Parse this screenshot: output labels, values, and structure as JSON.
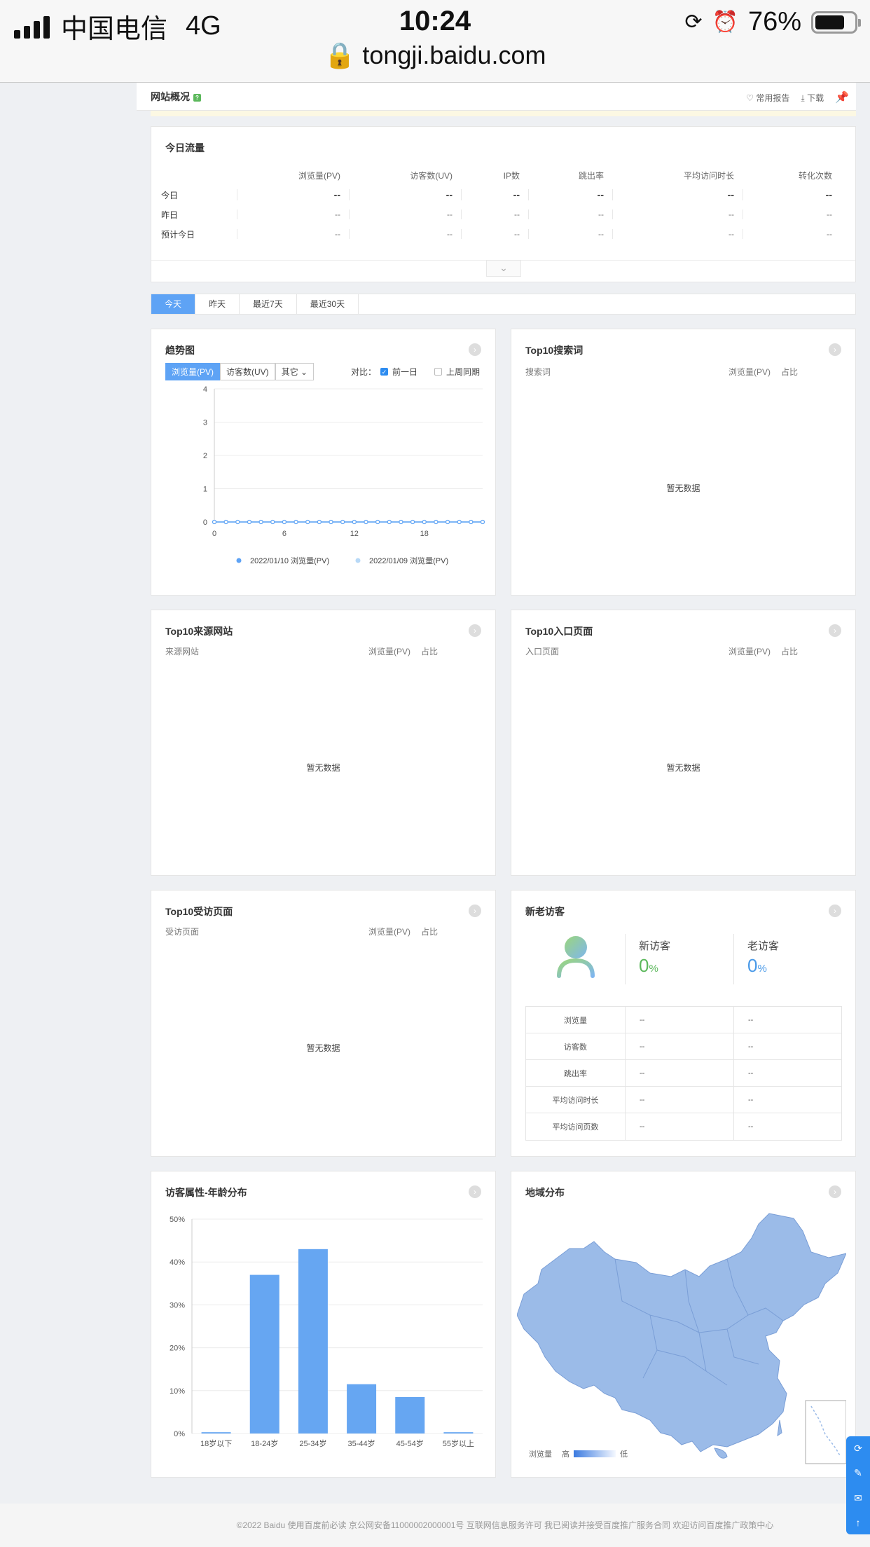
{
  "status_bar": {
    "carrier": "中国电信",
    "network": "4G",
    "time": "10:24",
    "battery": "76%",
    "url": "tongji.baidu.com"
  },
  "header": {
    "title": "网站概况",
    "badge": "?",
    "actions": [
      "常用报告",
      "下载"
    ]
  },
  "today_traffic": {
    "title": "今日流量",
    "columns": [
      "浏览量(PV)",
      "访客数(UV)",
      "IP数",
      "跳出率",
      "平均访问时长",
      "转化次数"
    ],
    "rows": [
      {
        "label": "今日",
        "values": [
          "--",
          "--",
          "--",
          "--",
          "--",
          "--"
        ]
      },
      {
        "label": "昨日",
        "values": [
          "--",
          "--",
          "--",
          "--",
          "--",
          "--"
        ]
      },
      {
        "label": "预计今日",
        "values": [
          "--",
          "--",
          "--",
          "--",
          "--",
          "--"
        ]
      }
    ]
  },
  "date_tabs": [
    "今天",
    "昨天",
    "最近7天",
    "最近30天"
  ],
  "trend": {
    "title": "趋势图",
    "metric_tabs": [
      "浏览量(PV)",
      "访客数(UV)",
      "其它"
    ],
    "compare_label": "对比：",
    "compare_options": [
      "前一日",
      "上周同期"
    ],
    "legend": [
      "2022/01/10 浏览量(PV)",
      "2022/01/09 浏览量(PV)"
    ]
  },
  "top_search": {
    "title": "Top10搜索词",
    "cols": [
      "搜索词",
      "浏览量(PV)",
      "占比"
    ],
    "empty": "暂无数据"
  },
  "top_source": {
    "title": "Top10来源网站",
    "cols": [
      "来源网站",
      "浏览量(PV)",
      "占比"
    ],
    "empty": "暂无数据"
  },
  "top_entry": {
    "title": "Top10入口页面",
    "cols": [
      "入口页面",
      "浏览量(PV)",
      "占比"
    ],
    "empty": "暂无数据"
  },
  "top_visited": {
    "title": "Top10受访页面",
    "cols": [
      "受访页面",
      "浏览量(PV)",
      "占比"
    ],
    "empty": "暂无数据"
  },
  "new_visitors": {
    "title": "新老访客",
    "new_label": "新访客",
    "old_label": "老访客",
    "new_pct": "0",
    "old_pct": "0",
    "pct_sign": "%",
    "rows": [
      {
        "label": "浏览量",
        "new": "--",
        "old": "--"
      },
      {
        "label": "访客数",
        "new": "--",
        "old": "--"
      },
      {
        "label": "跳出率",
        "new": "--",
        "old": "--"
      },
      {
        "label": "平均访问时长",
        "new": "--",
        "old": "--"
      },
      {
        "label": "平均访问页数",
        "new": "--",
        "old": "--"
      }
    ]
  },
  "age": {
    "title": "访客属性-年龄分布"
  },
  "geo": {
    "title": "地域分布",
    "legend_label": "浏览量",
    "high": "高",
    "low": "低"
  },
  "footer": {
    "text": "©2022 Baidu 使用百度前必读 京公网安备11000002000001号 互联网信息服务许可 我已阅读并接受百度推广服务合同 欢迎访问百度推广政策中心"
  },
  "chart_data": [
    {
      "type": "line",
      "x": [
        0,
        1,
        2,
        3,
        4,
        5,
        6,
        7,
        8,
        9,
        10,
        11,
        12,
        13,
        14,
        15,
        16,
        17,
        18,
        19,
        20,
        21,
        22,
        23
      ],
      "x_ticks": [
        "0",
        "6",
        "12",
        "18"
      ],
      "y_ticks": [
        "0",
        "1",
        "2",
        "3",
        "4"
      ],
      "ylim": [
        0,
        4
      ],
      "series": [
        {
          "name": "2022/01/10 浏览量(PV)",
          "color": "#5ea3f5",
          "values": [
            0,
            0,
            0,
            0,
            0,
            0,
            0,
            0,
            0,
            0,
            0,
            0,
            0,
            0,
            0,
            0,
            0,
            0,
            0,
            0,
            0,
            0,
            0,
            0
          ]
        },
        {
          "name": "2022/01/09 浏览量(PV)",
          "color": "#b8d9f7",
          "values": [
            0,
            0,
            0,
            0,
            0,
            0,
            0,
            0,
            0,
            0,
            0,
            0,
            0,
            0,
            0,
            0,
            0,
            0,
            0,
            0,
            0,
            0,
            0,
            0
          ]
        }
      ],
      "grid": true
    },
    {
      "type": "bar",
      "categories": [
        "18岁以下",
        "18-24岁",
        "25-34岁",
        "35-44岁",
        "45-54岁",
        "55岁以上"
      ],
      "values": [
        0.3,
        37,
        43,
        11.5,
        8.5,
        0.3
      ],
      "y_ticks": [
        "0%",
        "10%",
        "20%",
        "30%",
        "40%",
        "50%"
      ],
      "ylim": [
        0,
        50
      ],
      "color": "#66a6f2",
      "grid": true
    }
  ]
}
